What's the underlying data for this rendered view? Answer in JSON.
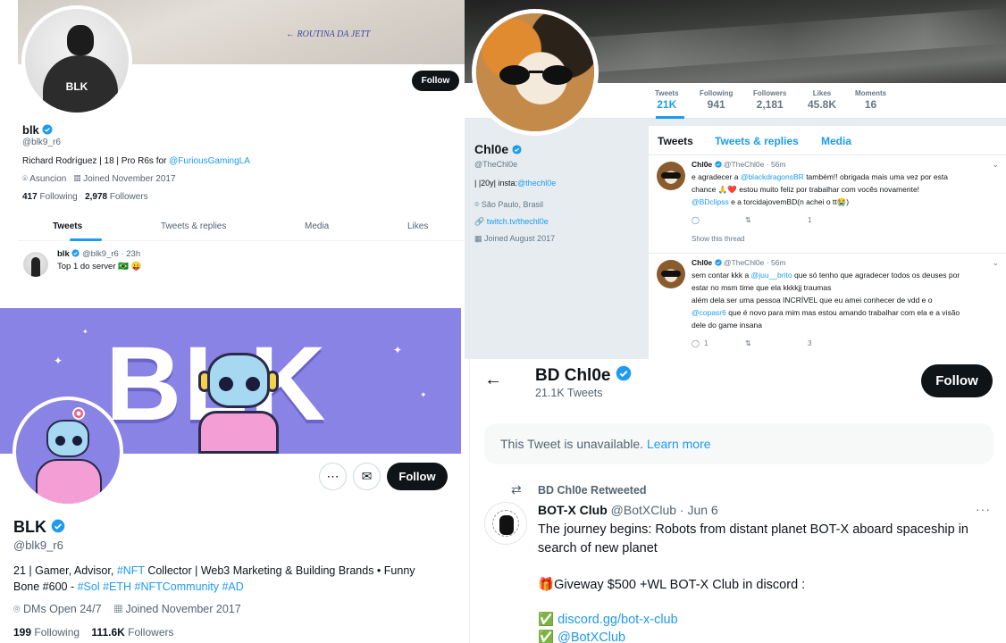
{
  "panel_a": {
    "banner_sketch_text": "← ROUTINA DA JETT",
    "avatar_text": "BLK",
    "follow_label": "Follow",
    "name": "blk",
    "handle": "@blk9_r6",
    "bio_text": "Richard Rodríguez | 18 | Pro R6s for ",
    "bio_mention": "@FuriousGamingLA",
    "location": "Asuncion",
    "joined": "Joined November 2017",
    "following_count": "417",
    "following_label": "Following",
    "followers_count": "2,978",
    "followers_label": "Followers",
    "tabs": [
      "Tweets",
      "Tweets & replies",
      "Media",
      "Likes"
    ],
    "tweet": {
      "name": "blk",
      "handle": "@blk9_r6",
      "time": "· 23h",
      "text": "Top 1 do server 🇧🇷 😛"
    }
  },
  "panel_b": {
    "stats": [
      {
        "label": "Tweets",
        "value": "21K"
      },
      {
        "label": "Following",
        "value": "941"
      },
      {
        "label": "Followers",
        "value": "2,181"
      },
      {
        "label": "Likes",
        "value": "45.8K"
      },
      {
        "label": "Moments",
        "value": "16"
      }
    ],
    "name": "Chl0e",
    "handle": "@TheChl0e",
    "bio_text": "|     |20y| insta:",
    "bio_mention": "@thechl0e",
    "location": "São Paulo, Brasil",
    "website": "twitch.tv/thechl0e",
    "joined": "Joined August 2017",
    "tabs": [
      "Tweets",
      "Tweets & replies",
      "Media"
    ],
    "tweets": [
      {
        "name": "Chl0e",
        "handle": "@TheChl0e",
        "time": "· 56m",
        "lines": [
          [
            "e agradecer a ",
            "@blackdragonsBR",
            " também!! obrigada mais uma vez por esta"
          ],
          [
            "chance 🙏❤️ estou muito feliz por trabalhar com vocês novamente!",
            "",
            ""
          ],
          [
            "",
            "@BDclipss",
            " e a torcidajovemBD(n achei o tt😭)"
          ]
        ],
        "likes": "1",
        "show_thread": "Show this thread"
      },
      {
        "name": "Chl0e",
        "handle": "@TheChl0e",
        "time": "· 56m",
        "lines": [
          [
            "sem contar kkk a ",
            "@juu__brito",
            " que só tenho que agradecer todos os deuses por"
          ],
          [
            "estar no msm time que ela kkkkjj traumas",
            "",
            ""
          ],
          [
            "além dela ser uma pessoa INCRÍVEL que eu amei conhecer de vdd e o",
            "",
            ""
          ],
          [
            "",
            "@copasr6",
            " que é novo para mim mas estou amando trabalhar com ela e a visão"
          ],
          [
            "dele do game insana",
            "",
            ""
          ]
        ],
        "replies": "1",
        "likes": "3"
      }
    ]
  },
  "panel_c": {
    "banner_text": "BLK",
    "follow_label": "Follow",
    "name": "BLK",
    "handle": "@blk9_r6",
    "bio_line1_a": "21 | Gamer, Advisor, ",
    "bio_line1_tag": "#NFT",
    "bio_line1_b": " Collector | Web3 Marketing & Building Brands • Funny",
    "bio_line2_a": "Bone #600 - ",
    "bio_line2_tags": "#Sol #ETH #NFTCommunity #AD",
    "dms": "DMs Open 24/7",
    "joined": "Joined November 2017",
    "following_count": "199",
    "following_label": "Following",
    "followers_count": "111.6K",
    "followers_label": "Followers"
  },
  "panel_d": {
    "name": "BD Chl0e",
    "tweet_count": "21.1K Tweets",
    "follow_label": "Follow",
    "unavailable_text": "This Tweet is unavailable.",
    "learn_more": "Learn more",
    "retweeted_by": "BD Chl0e Retweeted",
    "tweet": {
      "name": "BOT-X Club",
      "handle": "@BotXClub",
      "time": "· Jun 6",
      "line1": "The journey begins: Robots from distant planet BOT-X aboard spaceship in",
      "line2": "search of new planet",
      "giveaway": "Giveway $500 +WL BOT-X Club in discord :",
      "link1": "discord.gg/bot-x-club",
      "link2": "@BotXClub"
    }
  },
  "colors": {
    "accent": "#1d9bf0",
    "text": "#0f1419",
    "muted": "#536471",
    "banner_purple": "#8a83e6"
  }
}
